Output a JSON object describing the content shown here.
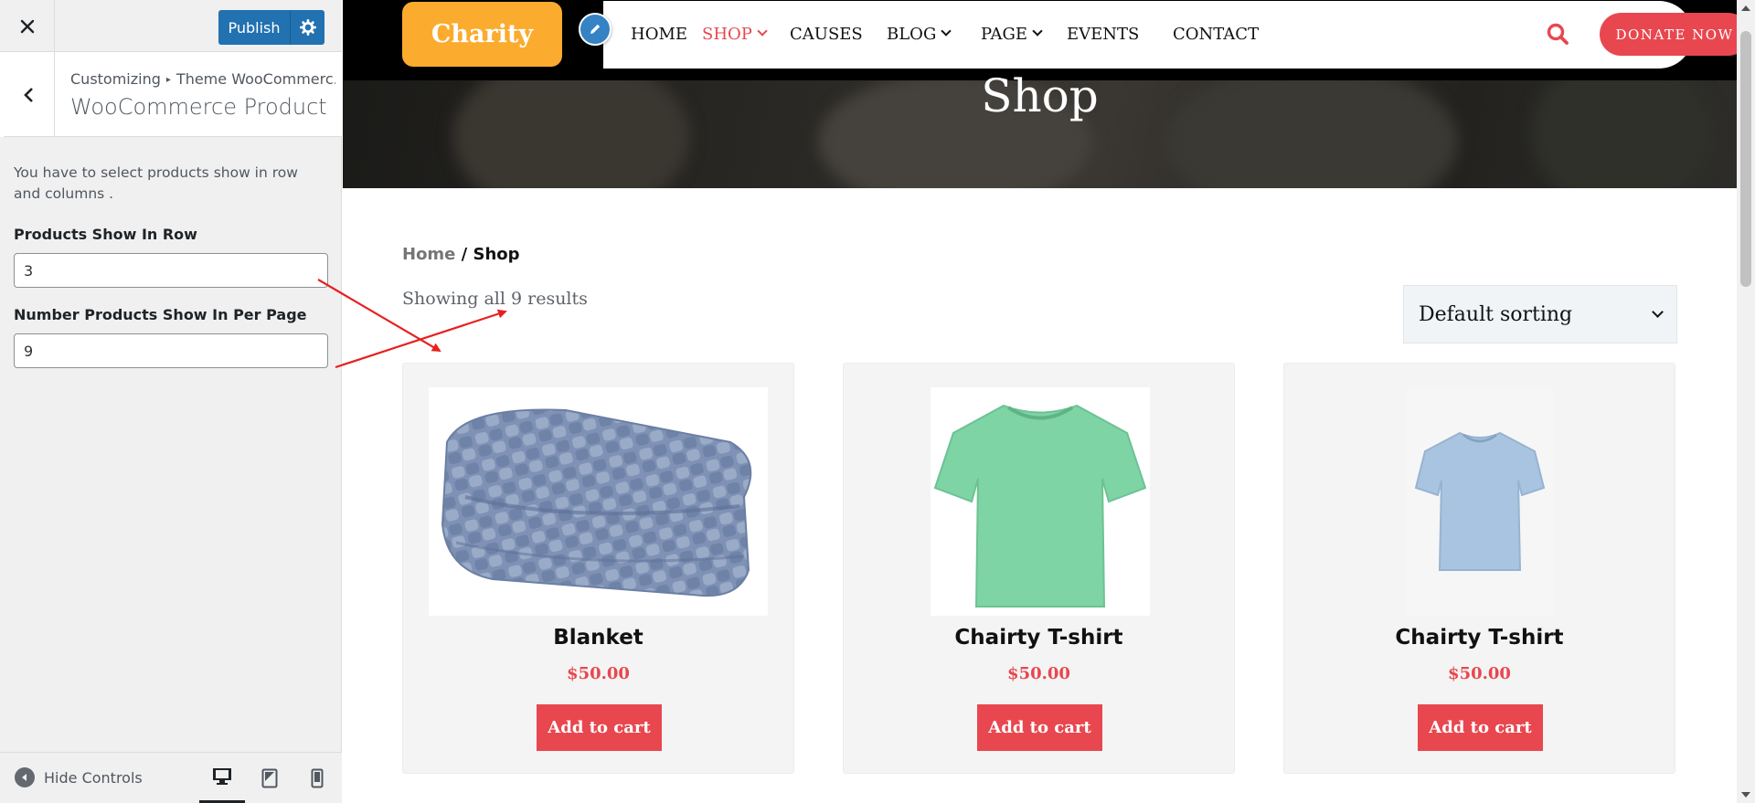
{
  "customizer": {
    "publish_label": "Publish",
    "breadcrumb_root": "Customizing",
    "breadcrumb_separator": "▸",
    "breadcrumb_section": "Theme WooCommerc...",
    "panel_title": "WooCommerce Product",
    "description": "You have to select products show in row and columns .",
    "fields": [
      {
        "label": "Products Show In Row",
        "value": "3"
      },
      {
        "label": "Number Products Show In Per Page",
        "value": "9"
      }
    ],
    "hide_controls_label": "Hide Controls",
    "active_device": "desktop"
  },
  "site": {
    "logo_text": "Charity",
    "nav": [
      {
        "label": "HOME",
        "has_dropdown": false,
        "active": false
      },
      {
        "label": "SHOP",
        "has_dropdown": true,
        "active": true
      },
      {
        "label": "CAUSES",
        "has_dropdown": false,
        "active": false
      },
      {
        "label": "BLOG",
        "has_dropdown": true,
        "active": false
      },
      {
        "label": "PAGE",
        "has_dropdown": true,
        "active": false
      },
      {
        "label": "EVENTS",
        "has_dropdown": false,
        "active": false
      },
      {
        "label": "CONTACT",
        "has_dropdown": false,
        "active": false
      }
    ],
    "donate_label": "DONATE NOW",
    "hero_title": "Shop",
    "accent_color": "#e8474f",
    "logo_color": "#fbab2d"
  },
  "shop": {
    "breadcrumb_home": "Home",
    "breadcrumb_separator": " / ",
    "breadcrumb_current": "Shop",
    "result_count": "Showing all 9 results",
    "sorting_selected": "Default sorting",
    "products": [
      {
        "name": "Blanket",
        "price": "$50.00",
        "button": "Add to cart",
        "image": "blanket-image"
      },
      {
        "name": "Chairty T-shirt",
        "price": "$50.00",
        "button": "Add to cart",
        "image": "green-tshirt-image"
      },
      {
        "name": "Chairty T-shirt",
        "price": "$50.00",
        "button": "Add to cart",
        "image": "blue-tshirt-image"
      }
    ]
  }
}
